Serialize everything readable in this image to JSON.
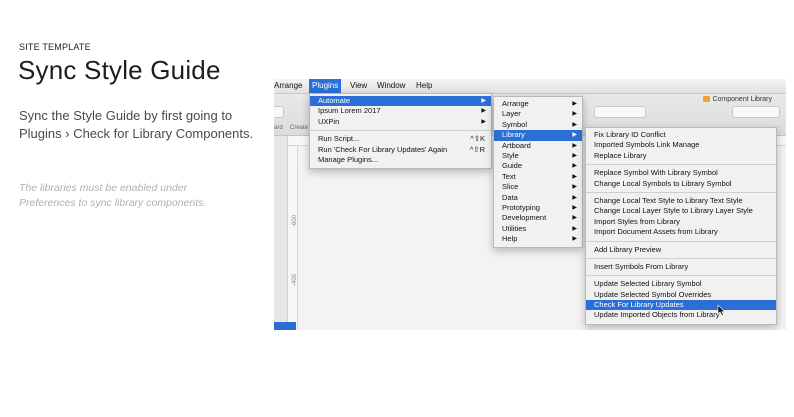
{
  "eyebrow": "SITE TEMPLATE",
  "title": "Sync Style Guide",
  "body": "Sync the Style Guide by first going to Plugins › Check for Library Components.",
  "note": "The libraries must be enabled under Preferences to sync library components.",
  "screenshot": {
    "menubar": [
      "Arrange",
      "Plugins",
      "View",
      "Window",
      "Help"
    ],
    "active_menu": "Plugins",
    "component_library": "Component Library",
    "toolbar_labels": [
      "ard",
      "Create"
    ],
    "ruler_numbers": [
      "-600",
      "-400"
    ],
    "plugins_menu": [
      {
        "label": "Automate",
        "submenu": true,
        "selected": true
      },
      {
        "label": "Ipsum Lorem 2017",
        "submenu": true
      },
      {
        "label": "UXPin",
        "submenu": true
      },
      {
        "separator": true
      },
      {
        "label": "Run Script...",
        "shortcut": "^⇧K"
      },
      {
        "label": "Run 'Check For Library Updates' Again",
        "shortcut": "^⇧R"
      },
      {
        "label": "Manage Plugins..."
      }
    ],
    "automate_menu": [
      {
        "label": "Arrange",
        "submenu": true
      },
      {
        "label": "Layer",
        "submenu": true
      },
      {
        "label": "Symbol",
        "submenu": true
      },
      {
        "label": "Library",
        "submenu": true,
        "selected": true
      },
      {
        "label": "Artboard",
        "submenu": true
      },
      {
        "label": "Style",
        "submenu": true
      },
      {
        "label": "Guide",
        "submenu": true
      },
      {
        "label": "Text",
        "submenu": true
      },
      {
        "label": "Slice",
        "submenu": true
      },
      {
        "label": "Data",
        "submenu": true
      },
      {
        "label": "Prototyping",
        "submenu": true
      },
      {
        "label": "Development",
        "submenu": true
      },
      {
        "label": "Utilities",
        "submenu": true
      },
      {
        "label": "Help",
        "submenu": true
      }
    ],
    "library_menu": [
      {
        "label": "Fix Library ID Conflict"
      },
      {
        "label": "Imported Symbols Link Manage"
      },
      {
        "label": "Replace Library"
      },
      {
        "separator": true
      },
      {
        "label": "Replace Symbol With Library Symbol"
      },
      {
        "label": "Change Local Symbols to Library Symbol"
      },
      {
        "separator": true
      },
      {
        "label": "Change Local Text Style to Library Text Style"
      },
      {
        "label": "Change Local Layer Style to Library Layer Style"
      },
      {
        "label": "Import Styles from Library"
      },
      {
        "label": "Import Document Assets from Library"
      },
      {
        "separator": true
      },
      {
        "label": "Add Library Preview"
      },
      {
        "separator": true
      },
      {
        "label": "Insert Symbols From Library"
      },
      {
        "separator": true
      },
      {
        "label": "Update Selected Library Symbol"
      },
      {
        "label": "Update Selected Symbol Overrides"
      },
      {
        "label": "Check For Library Updates",
        "selected": true
      },
      {
        "label": "Update Imported Objects from Library"
      }
    ]
  }
}
